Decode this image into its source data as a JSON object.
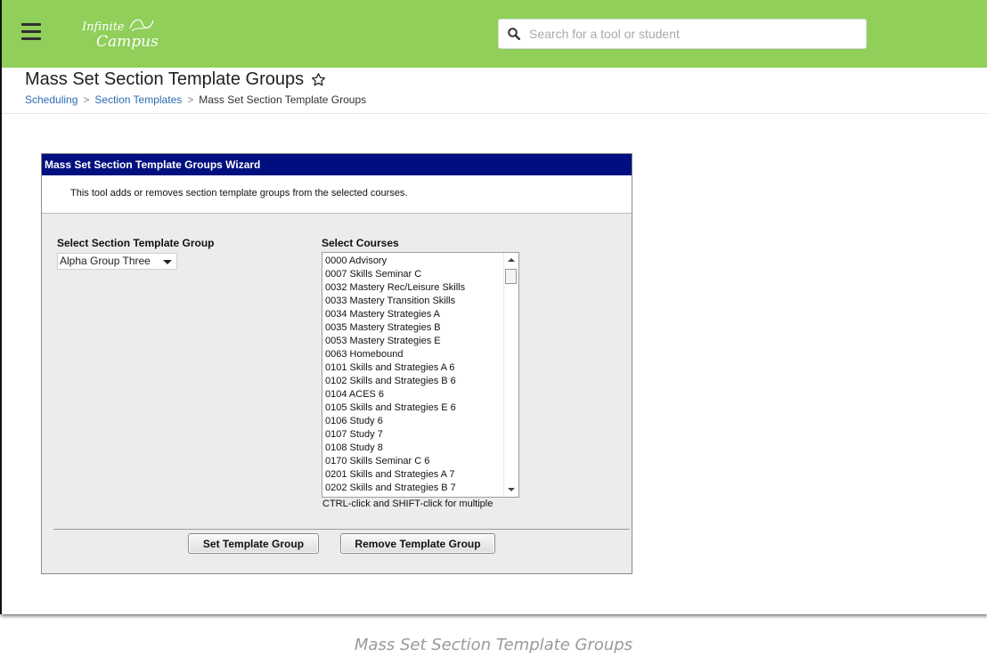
{
  "header": {
    "logo_line1": "Infinite",
    "logo_line2": "Campus",
    "search_placeholder": "Search for a tool or student"
  },
  "page": {
    "title": "Mass Set Section Template Groups",
    "breadcrumb": [
      "Scheduling",
      "Section Templates",
      "Mass Set Section Template Groups"
    ]
  },
  "wizard": {
    "title": "Mass Set Section Template Groups Wizard",
    "description": "This tool adds or removes section template groups from the selected courses.",
    "group_label": "Select Section Template Group",
    "group_selected": "Alpha Group Three",
    "courses_label": "Select Courses",
    "courses": [
      "0000 Advisory",
      "0007 Skills Seminar C",
      "0032 Mastery Rec/Leisure Skills",
      "0033 Mastery Transition Skills",
      "0034 Mastery Strategies A",
      "0035 Mastery Strategies B",
      "0053 Mastery Strategies E",
      "0063 Homebound",
      "0101 Skills and Strategies A 6",
      "0102 Skills and Strategies B 6",
      "0104 ACES 6",
      "0105 Skills and Strategies E 6",
      "0106 Study 6",
      "0107 Study 7",
      "0108 Study 8",
      "0170 Skills Seminar C 6",
      "0201 Skills and Strategies A 7",
      "0202 Skills and Strategies B 7"
    ],
    "hint": "CTRL-click and SHIFT-click for multiple",
    "set_button": "Set Template Group",
    "remove_button": "Remove Template Group"
  },
  "caption": "Mass Set Section Template Groups",
  "colors": {
    "topbar": "#8fcf5a",
    "wizard_header": "#000f7f",
    "link": "#2b6cb5"
  }
}
